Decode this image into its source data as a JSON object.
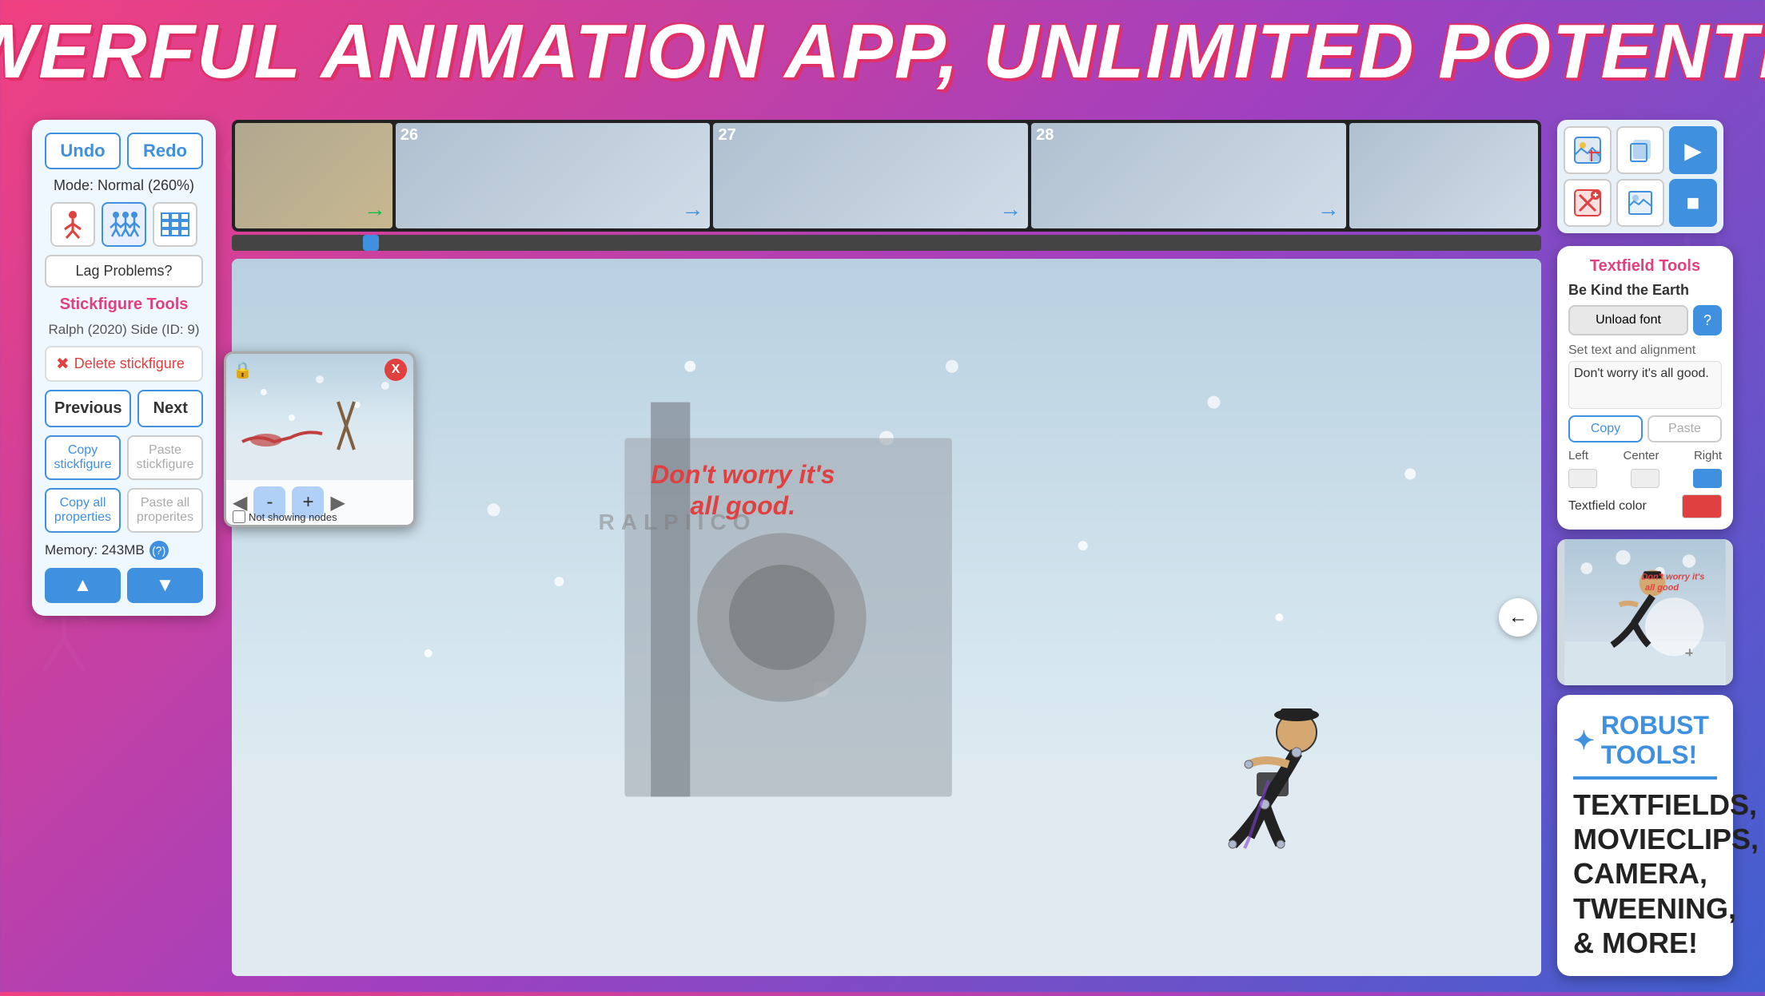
{
  "banner": {
    "text": "POWERFUL ANIMATION APP, UNLIMITED POTENTIAL!"
  },
  "left_panel": {
    "undo_label": "Undo",
    "redo_label": "Redo",
    "mode_text": "Mode: Normal (260%)",
    "lag_btn_label": "Lag Problems?",
    "stickfig_tools_title": "Stickfigure Tools",
    "stickfig_id": "Ralph (2020) Side (ID: 9)",
    "delete_label": "Delete stickfigure",
    "previous_label": "Previous",
    "next_label": "Next",
    "copy_sf_label": "Copy stickfigure",
    "paste_sf_label": "Paste stickfigure",
    "copy_all_label": "Copy all properties",
    "paste_all_label": "Paste all properites",
    "memory_label": "Memory: 243MB",
    "help_label": "(?)"
  },
  "filmstrip": {
    "frames": [
      {
        "num": "",
        "arrow": true
      },
      {
        "num": "26",
        "arrow": true
      },
      {
        "num": "27",
        "arrow": true
      },
      {
        "num": "28",
        "arrow": true
      },
      {
        "num": "",
        "arrow": false
      }
    ]
  },
  "canvas": {
    "text_overlay": "Don't worry it's\nall good.",
    "label": "RALPIICO"
  },
  "popup": {
    "close_label": "X",
    "minus_label": "-",
    "plus_label": "+",
    "checkbox_label": "Not showing nodes"
  },
  "textfield_tools": {
    "title": "Textfield Tools",
    "font_name": "Be Kind the Earth",
    "unload_btn": "Unload font",
    "question_btn": "?",
    "set_text_label": "Set text and alignment",
    "text_content": "Don't worry it's all good.",
    "copy_label": "Copy",
    "paste_label": "Paste",
    "align_left": "Left",
    "align_center": "Center",
    "align_right": "Right",
    "color_label": "Textfield color"
  },
  "robust_tools": {
    "icon": "✦",
    "title": "ROBUST TOOLS!",
    "description": "TEXTFIELDS, MOVIECLIPS, CAMERA, TWEENING, & MORE!"
  },
  "toolbar": {
    "btn1_icon": "🖼",
    "btn2_icon": "📋",
    "btn3_icon": "▶",
    "btn4_icon": "❌",
    "btn5_icon": "📄",
    "btn6_icon": "■"
  }
}
